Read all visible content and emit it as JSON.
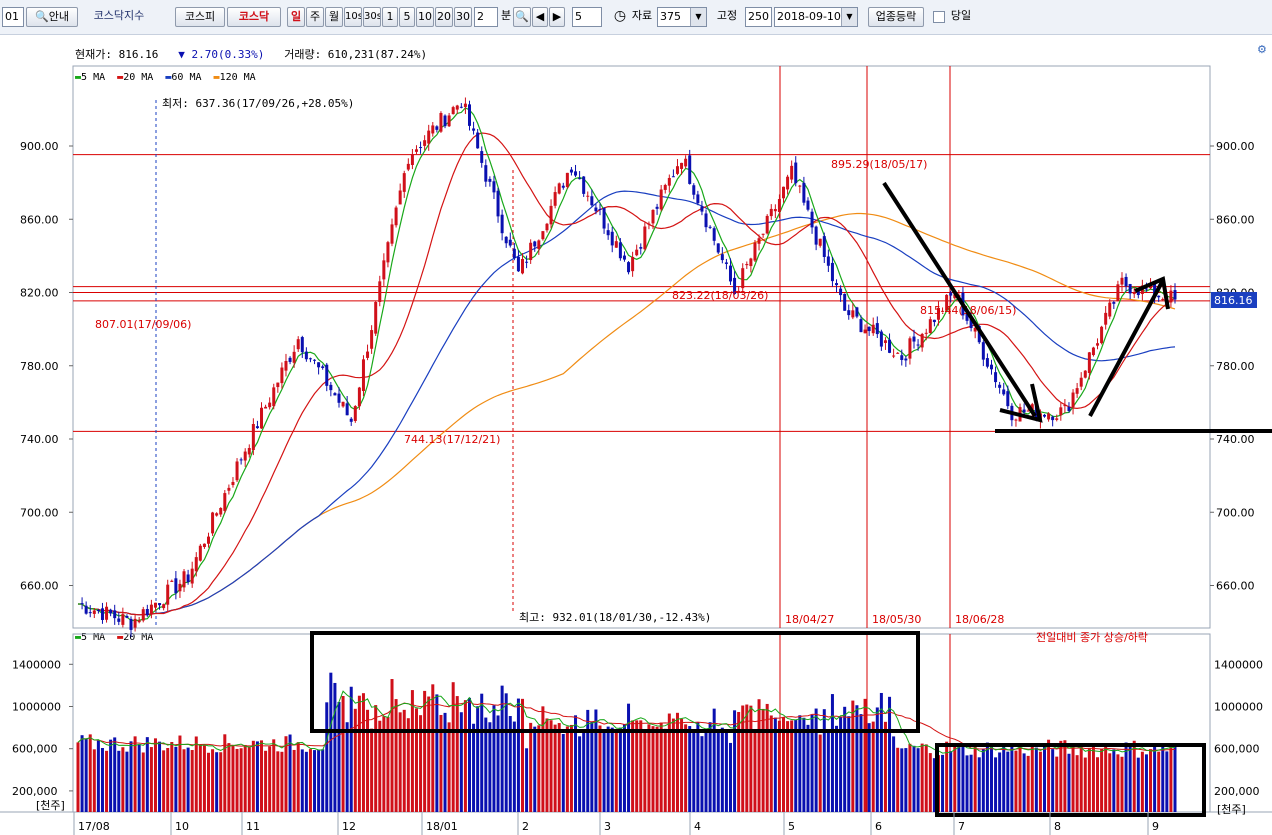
{
  "toolbar": {
    "code": "01",
    "guide_label": "안내",
    "index_name": "코스닥지수",
    "tabs": [
      "코스피",
      "코스닥"
    ],
    "active_tab": "코스닥",
    "periods": [
      "일",
      "주",
      "월",
      "10s",
      "30s",
      "1",
      "5",
      "10",
      "20",
      "30"
    ],
    "active_period": "일",
    "minute_value": "2",
    "minute_unit": "분",
    "step_value": "5",
    "data_label": "자료",
    "data_count": "375",
    "fixed_label": "고정",
    "fixed_value": "250",
    "date": "2018-09-10",
    "industry_button": "업종등락",
    "sameday_label": "당일"
  },
  "info": {
    "price": "현재가: 816.16",
    "change": "2.70(0.33%)",
    "volume": "거래량: 610,231(87.24%)"
  },
  "colors": {
    "up": "#d0101a",
    "down": "#0a10b0",
    "ma5": "#19a81a",
    "ma20": "#d41414",
    "ma60": "#1a3fc0",
    "ma120": "#f08c14",
    "grid": "#d90000"
  },
  "chart_data": [
    {
      "type": "candlestick",
      "legend": [
        "5 MA",
        "20 MA",
        "60 MA",
        "120 MA"
      ],
      "yticks": [
        "900.00",
        "860.00",
        "820.00",
        "780.00",
        "740.00",
        "700.00",
        "660.00"
      ],
      "ylim": [
        637,
        935
      ],
      "current_value": "816.16",
      "x_month_labels": [
        "17/08",
        "10",
        "11",
        "12",
        "18/01",
        "2",
        "3",
        "4",
        "5",
        "6",
        "7",
        "8",
        "9"
      ],
      "date_markers": [
        "18/04/27",
        "18/05/30",
        "18/06/28"
      ],
      "annotations": {
        "low": "최저: 637.36(17/09/26,+28.05%)",
        "high": "최고: 932.01(18/01/30,-12.43%)",
        "a_895": "895.29(18/05/17)",
        "a_823": "823.22(18/03/26)",
        "a_815": "815.44(18/06/15)",
        "a_807": "807.01(17/09/06)",
        "a_744": "744.13(17/12/21)"
      },
      "horizontal_levels": [
        895.29,
        823.22,
        815.44,
        744.13
      ],
      "key_points": [
        {
          "date": "17/08",
          "close": 650
        },
        {
          "date": "17/09/26",
          "close": 640
        },
        {
          "date": "17/10",
          "close": 665
        },
        {
          "date": "17/11",
          "close": 730
        },
        {
          "date": "17/11/24",
          "close": 795
        },
        {
          "date": "17/12/21",
          "close": 750
        },
        {
          "date": "18/01/16",
          "close": 895
        },
        {
          "date": "18/01/30",
          "close": 925
        },
        {
          "date": "18/02/09",
          "close": 830
        },
        {
          "date": "18/03/14",
          "close": 890
        },
        {
          "date": "18/03/26",
          "close": 835
        },
        {
          "date": "18/04/17",
          "close": 895
        },
        {
          "date": "18/05/03",
          "close": 820
        },
        {
          "date": "18/05/17",
          "close": 885
        },
        {
          "date": "18/06/15",
          "close": 810
        },
        {
          "date": "18/07/05",
          "close": 785
        },
        {
          "date": "18/07/13",
          "close": 820
        },
        {
          "date": "18/07/25",
          "close": 755
        },
        {
          "date": "18/08/16",
          "close": 755
        },
        {
          "date": "18/09/04",
          "close": 825
        },
        {
          "date": "18/09/10",
          "close": 816.16
        }
      ]
    },
    {
      "type": "bar",
      "legend": [
        "5 MA",
        "20 MA"
      ],
      "caption": "전일대비 종가 상승/하락",
      "unit": "[천주]",
      "yticks": [
        "1400000",
        "1000000",
        "600,000",
        "200,000"
      ],
      "ylim": [
        0,
        1700000
      ]
    }
  ]
}
